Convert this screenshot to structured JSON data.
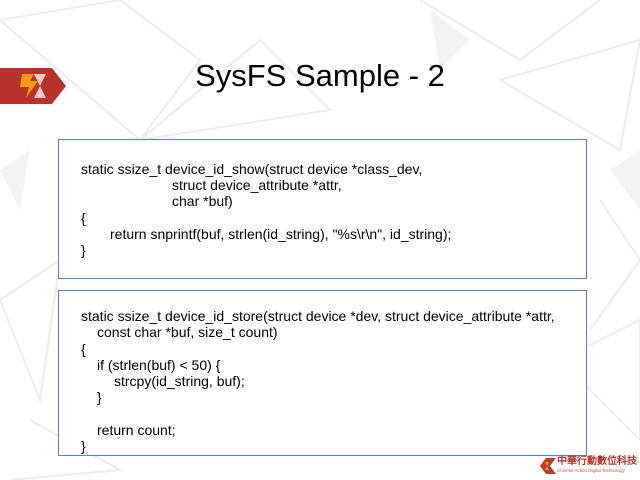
{
  "slide": {
    "title": "SysFS Sample - 2"
  },
  "code_show": {
    "lines": [
      "static ssize_t device_id_show(struct device *class_dev,",
      "struct device_attribute *attr,",
      "char *buf)",
      "{",
      "return snprintf(buf, strlen(id_string), \"%s\\r\\n\", id_string);",
      "}"
    ]
  },
  "code_store": {
    "lines": [
      "static ssize_t device_id_store(struct device *dev, struct device_attribute *attr,",
      "const char *buf, size_t count)",
      "{",
      "if (strlen(buf) < 50) {",
      "strcpy(id_string, buf);",
      "}",
      "return count;",
      "}"
    ]
  },
  "brand": {
    "name": "中華行動數位科技",
    "subtitle": "Chinese Action Digital Technology"
  },
  "colors": {
    "box_border": "#5b7fb8",
    "logo_red": "#c0392b",
    "logo_orange": "#e67e22",
    "pattern_gray": "#e8e8e8"
  },
  "icons": {
    "logo_left": "company-logo-mark",
    "brand_logo": "company-logo-mark"
  }
}
